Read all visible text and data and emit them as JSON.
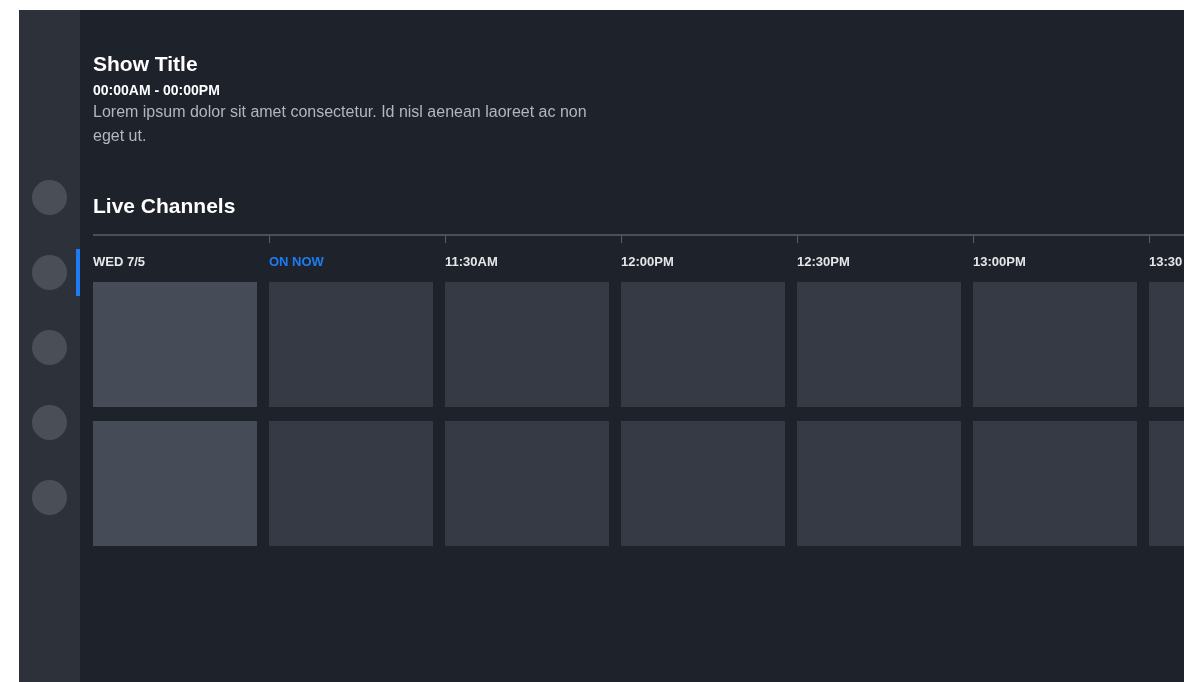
{
  "sidebar": {
    "items": [
      {
        "selected": false
      },
      {
        "selected": true
      },
      {
        "selected": false
      },
      {
        "selected": false
      },
      {
        "selected": false
      }
    ]
  },
  "show": {
    "title": "Show Title",
    "time": "00:00AM - 00:00PM",
    "description": "Lorem ipsum dolor sit amet consectetur. Id nisl aenean laoreet ac non eget ut."
  },
  "section_title": "Live Channels",
  "timeline": [
    {
      "label": "WED 7/5",
      "live": false
    },
    {
      "label": "ON NOW",
      "live": true
    },
    {
      "label": "11:30AM",
      "live": false
    },
    {
      "label": "12:00PM",
      "live": false
    },
    {
      "label": "12:30PM",
      "live": false
    },
    {
      "label": "13:00PM",
      "live": false
    },
    {
      "label": "13:30",
      "live": false
    }
  ],
  "rows": [
    {
      "tiles": [
        {
          "kind": "channel"
        },
        {
          "kind": "program"
        },
        {
          "kind": "program"
        },
        {
          "kind": "program"
        },
        {
          "kind": "program"
        },
        {
          "kind": "program"
        },
        {
          "kind": "program"
        }
      ]
    },
    {
      "tiles": [
        {
          "kind": "channel"
        },
        {
          "kind": "program"
        },
        {
          "kind": "program"
        },
        {
          "kind": "program"
        },
        {
          "kind": "program"
        },
        {
          "kind": "program"
        },
        {
          "kind": "program"
        }
      ]
    }
  ]
}
